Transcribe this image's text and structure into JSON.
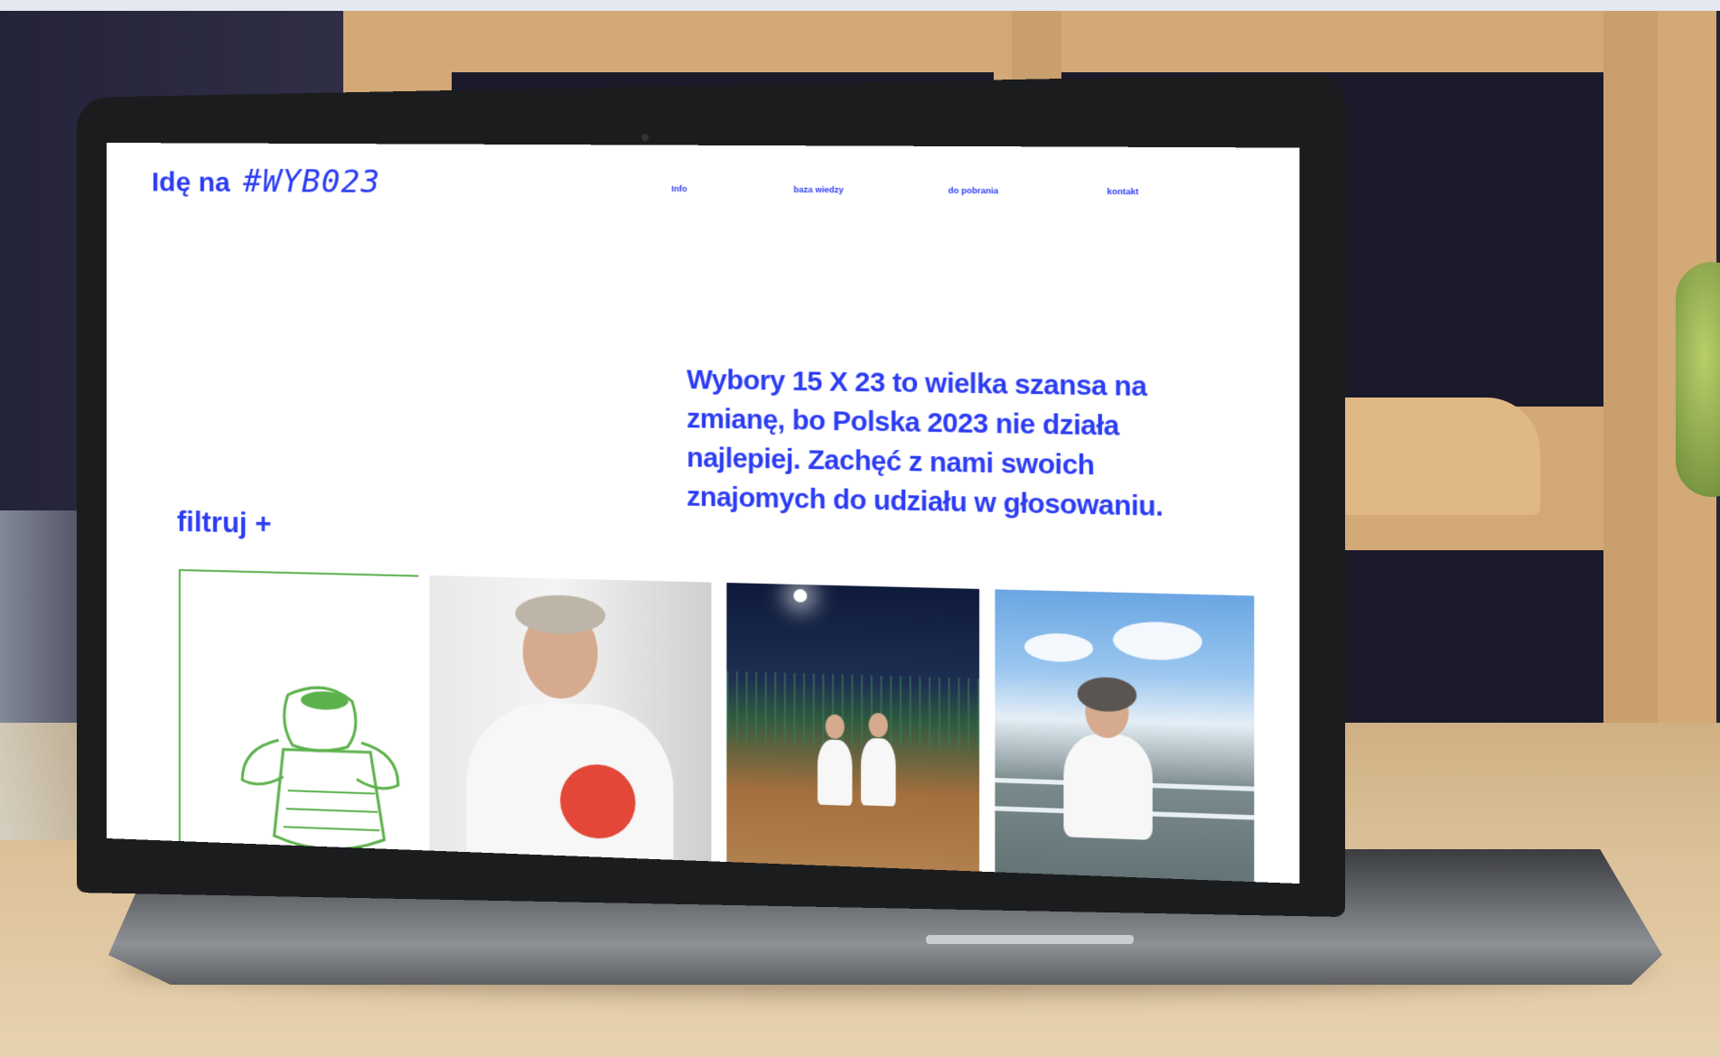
{
  "site": {
    "logo_text": "Idę na",
    "logo_tag": "#WYB023"
  },
  "nav": {
    "items": [
      {
        "label": "Info"
      },
      {
        "label": "baza wiedzy"
      },
      {
        "label": "do pobrania"
      },
      {
        "label": "kontakt"
      }
    ]
  },
  "hero": {
    "text": "Wybory 15 X 23 to wielka szansa na zmianę, bo Polska 2023 nie działa najlepiej. Zachęć z nami swoich znajomych do udziału w głosowaniu."
  },
  "filter": {
    "label": "filtruj +"
  },
  "gallery": {
    "items": [
      {
        "kind": "illustration",
        "icon": "mascot-illustration"
      },
      {
        "kind": "photo",
        "subject": "man-in-tshirt-photo"
      },
      {
        "kind": "photo",
        "subject": "two-women-tennis-court-photo"
      },
      {
        "kind": "photo",
        "subject": "woman-on-pier-photo"
      }
    ]
  },
  "colors": {
    "accent": "#2c3cf3",
    "illustration_green": "#5bb14a"
  }
}
